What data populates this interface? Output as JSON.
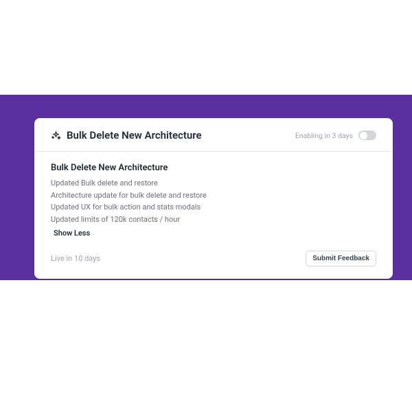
{
  "header": {
    "title": "Bulk Delete New Architecture",
    "enabling_label": "Enabling in 3 days"
  },
  "body": {
    "title": "Bulk Delete New Architecture",
    "lines": [
      "Updated Bulk delete and restore",
      "Architecture update for bulk delete and restore",
      "Updated UX for bulk action and stats modals",
      "Updated limits of 120k contacts / hour"
    ],
    "show_less": "Show Less"
  },
  "footer": {
    "live_label": "Live in 10 days",
    "submit_label": "Submit Feedback"
  }
}
